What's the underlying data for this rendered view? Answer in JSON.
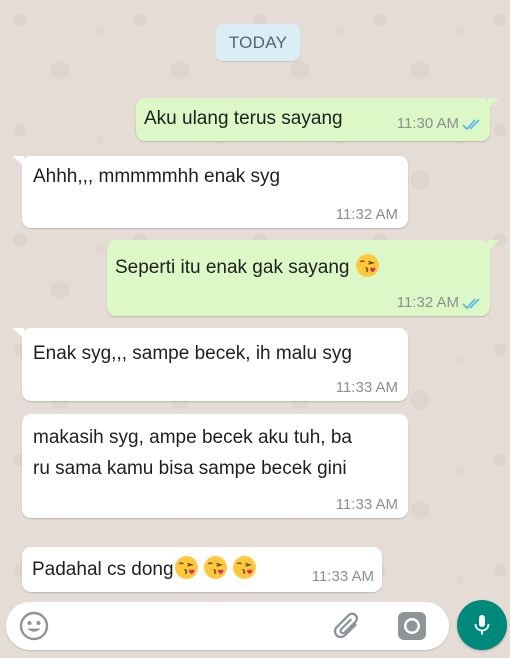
{
  "chat": {
    "date_chip": "TODAY",
    "messages": [
      {
        "direction": "outgoing",
        "text": "Aku ulang terus sayang",
        "time": "11:30 AM",
        "status": "read"
      },
      {
        "direction": "incoming",
        "text": "Ahhh,,, mmmmmhh enak syg",
        "time": "11:32 AM"
      },
      {
        "direction": "outgoing",
        "text": "Seperti itu enak gak sayang",
        "emoji_count": 1,
        "emoji": "face-blowing-kiss",
        "time": "11:32 AM",
        "status": "read"
      },
      {
        "direction": "incoming",
        "text": "Enak syg,,, sampe becek, ih malu syg",
        "time": "11:33 AM"
      },
      {
        "direction": "incoming",
        "lines": [
          "makasih syg, ampe becek aku tuh, ba",
          "ru sama kamu bisa sampe becek gini"
        ],
        "time": "11:33 AM"
      },
      {
        "direction": "incoming",
        "text": "Padahal cs dong",
        "emoji_count": 3,
        "emoji": "face-blowing-kiss",
        "time": "11:33 AM"
      }
    ]
  },
  "input_bar": {
    "icons": [
      "emoji-icon",
      "paperclip-icon",
      "camera-icon",
      "microphone-icon"
    ]
  },
  "colors": {
    "outgoing_bubble": "#dcf8c6",
    "incoming_bubble": "#ffffff",
    "read_ticks": "#4fb6ec",
    "mic_button": "#00897b",
    "wallpaper": "#e5ddd5"
  }
}
